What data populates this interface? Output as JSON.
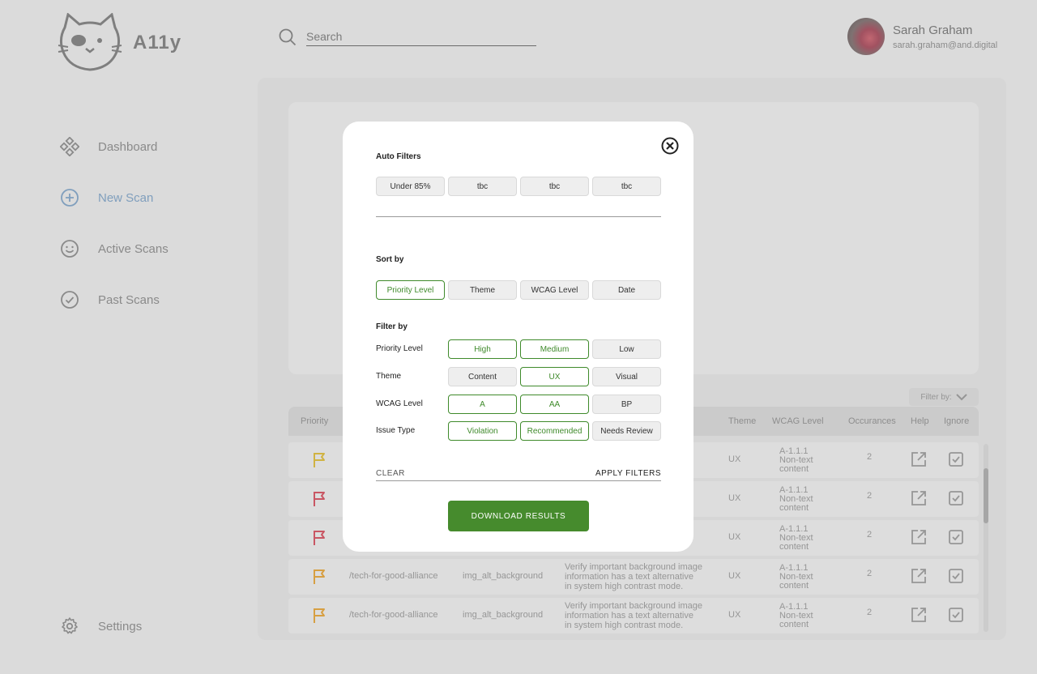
{
  "brand": {
    "name": "A11y"
  },
  "search": {
    "placeholder": "Search"
  },
  "user": {
    "name": "Sarah Graham",
    "email": "sarah.graham@and.digital"
  },
  "sidebar": {
    "items": [
      {
        "label": "Dashboard",
        "icon": "dashboard-icon"
      },
      {
        "label": "New Scan",
        "icon": "plus-circle-icon",
        "active": true
      },
      {
        "label": "Active Scans",
        "icon": "smiley-icon"
      },
      {
        "label": "Past Scans",
        "icon": "check-circle-icon"
      }
    ],
    "settings_label": "Settings"
  },
  "results": {
    "filter_by_label": "Filter by:",
    "columns": [
      "Priority",
      "Theme",
      "WCAG Level",
      "Occurances",
      "Help",
      "Ignore"
    ],
    "rows": [
      {
        "priority_color": "#e8c84a",
        "path": "",
        "rule": "",
        "description": [
          "",
          "",
          ""
        ],
        "theme": "UX",
        "wcag": [
          "A-1.1.1",
          "Non-text",
          "content"
        ],
        "occurrences": "2"
      },
      {
        "priority_color": "#e0606f",
        "path": "",
        "rule": "",
        "description": [
          "",
          "",
          ""
        ],
        "theme": "UX",
        "wcag": [
          "A-1.1.1",
          "Non-text",
          "content"
        ],
        "occurrences": "2"
      },
      {
        "priority_color": "#e0606f",
        "path": "",
        "rule": "",
        "description": [
          "",
          "",
          ""
        ],
        "theme": "UX",
        "wcag": [
          "A-1.1.1",
          "Non-text",
          "content"
        ],
        "occurrences": "2"
      },
      {
        "priority_color": "#f0b24a",
        "path": "/tech-for-good-alliance",
        "rule": "img_alt_background",
        "description": [
          "Verify important background image",
          "information has a text alternative",
          "in system high contrast mode."
        ],
        "theme": "UX",
        "wcag": [
          "A-1.1.1",
          "Non-text",
          "content"
        ],
        "occurrences": "2"
      },
      {
        "priority_color": "#f0b24a",
        "path": "/tech-for-good-alliance",
        "rule": "img_alt_background",
        "description": [
          "Verify important background image",
          "information has a text alternative",
          "in system high contrast mode."
        ],
        "theme": "UX",
        "wcag": [
          "A-1.1.1",
          "Non-text",
          "content"
        ],
        "occurrences": "2"
      }
    ]
  },
  "modal": {
    "auto_filters_title": "Auto Filters",
    "auto_filters": [
      {
        "label": "Under 85%",
        "selected": false
      },
      {
        "label": "tbc",
        "selected": false
      },
      {
        "label": "tbc",
        "selected": false
      },
      {
        "label": "tbc",
        "selected": false
      }
    ],
    "sort_title": "Sort by",
    "sort_options": [
      {
        "label": "Priority Level",
        "selected": true
      },
      {
        "label": "Theme",
        "selected": false
      },
      {
        "label": "WCAG Level",
        "selected": false
      },
      {
        "label": "Date",
        "selected": false
      }
    ],
    "filter_title": "Filter by",
    "filter_groups": [
      {
        "label": "Priority Level",
        "options": [
          {
            "label": "High",
            "selected": true
          },
          {
            "label": "Medium",
            "selected": true
          },
          {
            "label": "Low",
            "selected": false
          }
        ]
      },
      {
        "label": "Theme",
        "options": [
          {
            "label": "Content",
            "selected": false
          },
          {
            "label": "UX",
            "selected": true
          },
          {
            "label": "Visual",
            "selected": false
          }
        ]
      },
      {
        "label": "WCAG Level",
        "options": [
          {
            "label": "A",
            "selected": true
          },
          {
            "label": "AA",
            "selected": true
          },
          {
            "label": "BP",
            "selected": false
          }
        ]
      },
      {
        "label": "Issue Type",
        "options": [
          {
            "label": "Violation",
            "selected": true
          },
          {
            "label": "Recommended",
            "selected": true
          },
          {
            "label": "Needs Review",
            "selected": false
          }
        ]
      }
    ],
    "clear_label": "CLEAR",
    "apply_label": "APPLY FILTERS",
    "download_label": "DOWNLOAD RESULTS"
  },
  "colors": {
    "accent_green": "#468b2d",
    "selected_border": "#3f8a2b",
    "nav_active": "#8fb1d3"
  }
}
